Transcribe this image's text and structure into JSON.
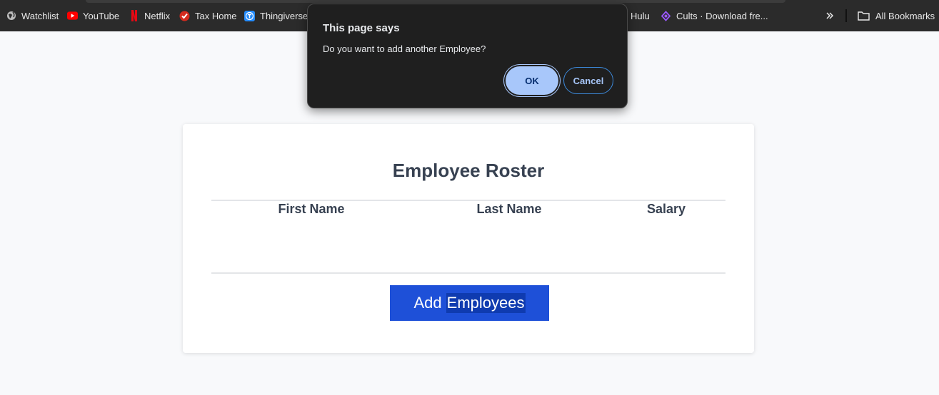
{
  "bookmarks": {
    "items": [
      {
        "label": "Watchlist",
        "icon": "globe-icon"
      },
      {
        "label": "YouTube",
        "icon": "youtube-icon"
      },
      {
        "label": "Netflix",
        "icon": "netflix-icon"
      },
      {
        "label": "Tax Home",
        "icon": "checkmark-icon"
      },
      {
        "label": "Thingiverse",
        "icon": "thingiverse-icon"
      },
      {
        "label": "Hulu",
        "icon": "hulu-icon"
      },
      {
        "label": "Cults · Download fre...",
        "icon": "cults-icon"
      }
    ],
    "overflow_icon": "chevron-double-right-icon",
    "all_bookmarks_label": "All Bookmarks"
  },
  "dialog": {
    "title": "This page says",
    "message": "Do you want to add another Employee?",
    "ok_label": "OK",
    "cancel_label": "Cancel"
  },
  "roster": {
    "title": "Employee Roster",
    "columns": [
      "First Name",
      "Last Name",
      "Salary"
    ],
    "rows": [],
    "add_button_word1": "Add",
    "add_button_word2": "Employees"
  },
  "colors": {
    "bookmarks_bar_bg": "#2b2b2b",
    "page_bg": "#f8f9fb",
    "primary_button": "#1e50d8",
    "dialog_bg": "#1f1f1f",
    "dialog_ok": "#a8c7fa"
  }
}
